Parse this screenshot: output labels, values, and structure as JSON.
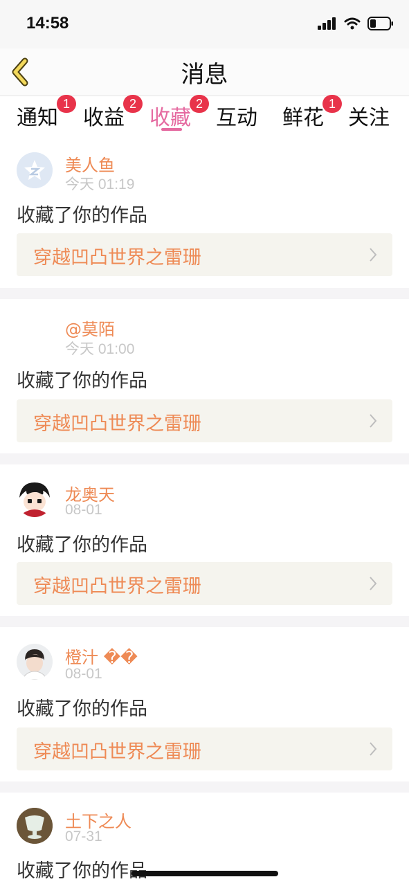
{
  "status_bar": {
    "time": "14:58"
  },
  "header": {
    "title": "消息"
  },
  "tabs": [
    {
      "label": "通知",
      "badge": "1"
    },
    {
      "label": "收益",
      "badge": "2"
    },
    {
      "label": "收藏",
      "badge": "2",
      "active": true
    },
    {
      "label": "互动",
      "badge": ""
    },
    {
      "label": "鲜花",
      "badge": "1"
    },
    {
      "label": "关注",
      "badge": ""
    }
  ],
  "feed": [
    {
      "username": "美人鱼",
      "time": "今天 01:19",
      "action": "收藏了你的作品",
      "work_title": "穿越凹凸世界之雷珊",
      "avatar": "default-logo-avatar"
    },
    {
      "username": "@莫陌",
      "time": "今天 01:00",
      "action": "收藏了你的作品",
      "work_title": "穿越凹凸世界之雷珊",
      "avatar": "blank-avatar"
    },
    {
      "username": "龙奥天",
      "time": "08-01",
      "action": "收藏了你的作品",
      "work_title": "穿越凹凸世界之雷珊",
      "avatar": "cartoon-boy-avatar"
    },
    {
      "username": "橙汁",
      "username_suffix": "��",
      "time": "08-01",
      "action": "收藏了你的作品",
      "work_title": "穿越凹凸世界之雷珊",
      "avatar": "photo-avatar"
    },
    {
      "username": "土下之人",
      "time": "07-31",
      "action": "收藏了你的作品",
      "work_title": "",
      "avatar": "cup-avatar"
    }
  ],
  "colors": {
    "accent_pink": "#e56aa0",
    "username_orange": "#ee8a55",
    "badge_red": "#e8334a"
  }
}
